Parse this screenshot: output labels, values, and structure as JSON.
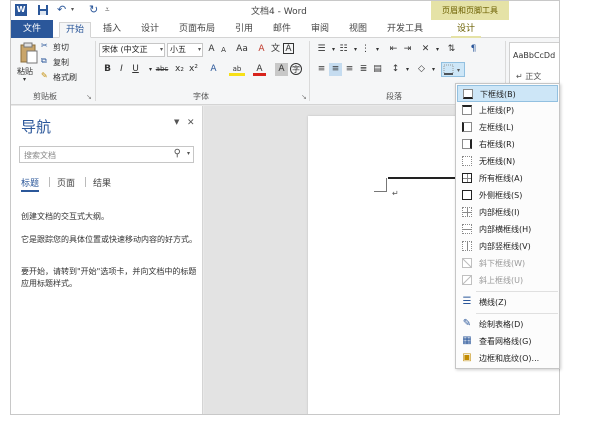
{
  "titlebar": {
    "app_icon": "W",
    "doc_title": "文档4 - Word",
    "context_group": "页眉和页脚工具",
    "icons": [
      "word-logo",
      "save-icon",
      "undo-icon",
      "redo-icon",
      "customize-dropdown-icon"
    ]
  },
  "tabs": [
    {
      "label": "文件"
    },
    {
      "label": "开始"
    },
    {
      "label": "插入"
    },
    {
      "label": "设计"
    },
    {
      "label": "页面布局"
    },
    {
      "label": "引用"
    },
    {
      "label": "邮件"
    },
    {
      "label": "审阅"
    },
    {
      "label": "视图"
    },
    {
      "label": "开发工具"
    },
    {
      "label": "设计"
    }
  ],
  "ribbon": {
    "clipboard": {
      "paste": "粘贴",
      "cut": "剪切",
      "copy": "复制",
      "format_painter": "格式刷",
      "group_label": "剪贴板"
    },
    "font": {
      "font_name": "宋体 (中文正",
      "font_size": "小五",
      "grow": "A",
      "shrink": "A",
      "case": "Aa",
      "clear": "A",
      "phonetic": "文",
      "border_char": "A",
      "bold": "B",
      "italic": "I",
      "underline": "U",
      "strike": "abc",
      "subscript": "x₂",
      "superscript": "x²",
      "text_effects": "A",
      "highlight": "ab",
      "font_color": "A",
      "char_shading": "A",
      "enclosed": "字",
      "group_label": "字体"
    },
    "paragraph": {
      "group_label": "段落"
    },
    "styles": {
      "preview": "AaBbCcDd",
      "name": "正文"
    }
  },
  "nav": {
    "title": "导航",
    "search_placeholder": "搜索文档",
    "tabs": [
      "标题",
      "页面",
      "结果"
    ],
    "messages": [
      "创建文档的交互式大纲。",
      "它是跟踪您的具体位置或快速移动内容的好方式。",
      "要开始，请转到\"开始\"选项卡，并向文档中的标题应用标题样式。"
    ]
  },
  "document": {
    "paragraph_mark": "↵"
  },
  "border_menu": {
    "items": [
      {
        "label": "下框线(B)",
        "icon": "bottom-border-icon",
        "enabled": true,
        "highlighted": true
      },
      {
        "label": "上框线(P)",
        "icon": "top-border-icon",
        "enabled": true,
        "highlighted": false
      },
      {
        "label": "左框线(L)",
        "icon": "left-border-icon",
        "enabled": true,
        "highlighted": false
      },
      {
        "label": "右框线(R)",
        "icon": "right-border-icon",
        "enabled": true,
        "highlighted": false
      },
      {
        "label": "无框线(N)",
        "icon": "no-border-icon",
        "enabled": true,
        "highlighted": false
      },
      {
        "label": "所有框线(A)",
        "icon": "all-borders-icon",
        "enabled": true,
        "highlighted": false
      },
      {
        "label": "外侧框线(S)",
        "icon": "outside-borders-icon",
        "enabled": true,
        "highlighted": false
      },
      {
        "label": "内部框线(I)",
        "icon": "inside-borders-icon",
        "enabled": true,
        "highlighted": false
      },
      {
        "label": "内部横框线(H)",
        "icon": "inside-horizontal-border-icon",
        "enabled": true,
        "highlighted": false
      },
      {
        "label": "内部竖框线(V)",
        "icon": "inside-vertical-border-icon",
        "enabled": true,
        "highlighted": false
      },
      {
        "label": "斜下框线(W)",
        "icon": "diagonal-down-border-icon",
        "enabled": false,
        "highlighted": false
      },
      {
        "label": "斜上框线(U)",
        "icon": "diagonal-up-border-icon",
        "enabled": false,
        "highlighted": false
      },
      {
        "label": "横线(Z)",
        "icon": "horizontal-line-icon",
        "enabled": true,
        "highlighted": false
      },
      {
        "label": "绘制表格(D)",
        "icon": "draw-table-icon",
        "enabled": true,
        "highlighted": false
      },
      {
        "label": "查看网格线(G)",
        "icon": "view-gridlines-icon",
        "enabled": true,
        "highlighted": false
      },
      {
        "label": "边框和底纹(O)...",
        "icon": "borders-and-shading-icon",
        "enabled": true,
        "highlighted": false
      }
    ]
  }
}
